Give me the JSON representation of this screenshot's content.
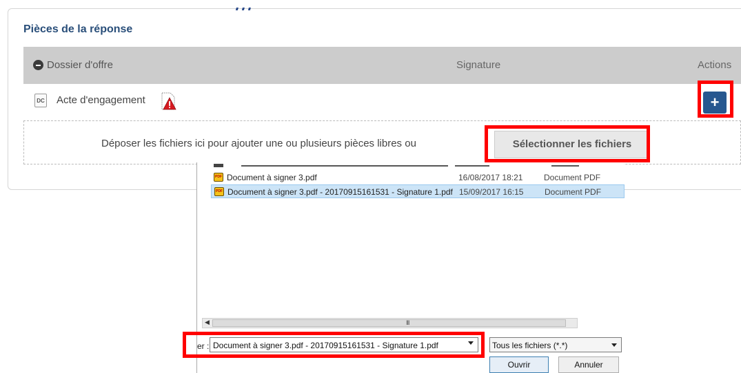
{
  "panel": {
    "title": "Pièces de la réponse",
    "table": {
      "headers": {
        "dossier": "Dossier d'offre",
        "signature": "Signature",
        "actions": "Actions"
      },
      "rows": [
        {
          "icon": "DC",
          "label": "Acte d'engagement"
        }
      ]
    },
    "dropzone": {
      "text": "Déposer les fichiers ici pour ajouter une ou plusieurs pièces libres ou",
      "select_button": "Sélectionner les fichiers"
    },
    "add_button": "+"
  },
  "dialog": {
    "files": [
      {
        "name": "Document à signer 3.pdf",
        "date": "16/08/2017 18:21",
        "type": "Document PDF",
        "selected": false
      },
      {
        "name": "Document à signer 3.pdf - 20170915161531 - Signature 1.pdf",
        "date": "15/09/2017 16:15",
        "type": "Document PDF",
        "selected": true
      }
    ],
    "scrollbar_grip": "III",
    "filename_prefix": "er :",
    "filename_value": "Document à signer 3.pdf - 20170915161531 - Signature 1.pdf",
    "filetype_value": "Tous les fichiers (*.*)",
    "open_button": "Ouvrir",
    "cancel_button": "Annuler"
  },
  "colors": {
    "highlight": "#ff0000",
    "primary": "#27578f",
    "header_bg": "#cccccc",
    "title": "#2a4f7a",
    "selection": "#cce4f7"
  },
  "icons": [
    "minus-circle-icon",
    "dc-document-icon",
    "warning-document-icon",
    "plus-icon",
    "pdf-file-icon",
    "chevron-down-icon",
    "scroll-left-icon"
  ]
}
